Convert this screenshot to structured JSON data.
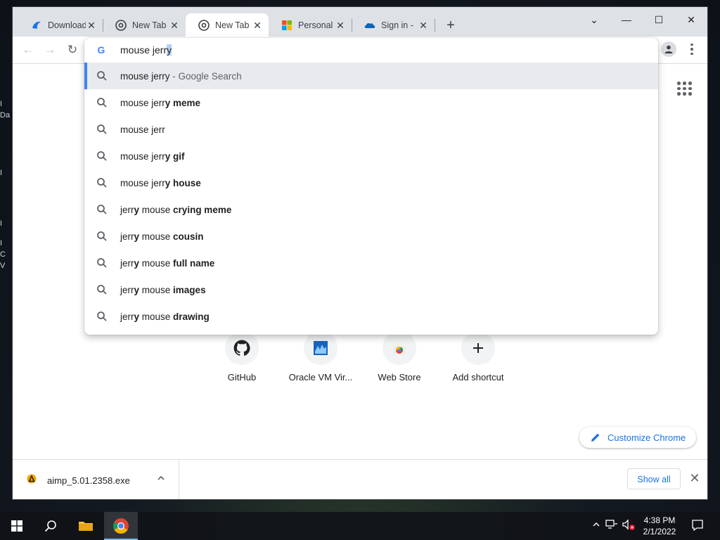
{
  "window": {
    "tabs": [
      {
        "title": "Download",
        "favicon": "download-favicon"
      },
      {
        "title": "New Tab",
        "favicon": "chrome-favicon"
      },
      {
        "title": "New Tab",
        "favicon": "chrome-favicon",
        "active": true
      },
      {
        "title": "Personal",
        "favicon": "microsoft-favicon"
      },
      {
        "title": "Sign in - ",
        "favicon": "onedrive-favicon"
      }
    ],
    "new_tab_label": "+",
    "controls": {
      "tab_search": "⌄",
      "minimize": "—",
      "maximize": "☐",
      "close": "✕"
    }
  },
  "toolbar": {
    "back": "←",
    "forward": "→",
    "reload": "↻"
  },
  "omnibox": {
    "typed_prefix": "mouse jerr",
    "typed_selected": "y",
    "suggestions": [
      {
        "plain": "mouse jerry",
        "bold": "",
        "hint": " - Google Search",
        "selected": true
      },
      {
        "plain": "mouse jerr",
        "bold": "y meme",
        "hint": ""
      },
      {
        "plain": "mouse jerr",
        "bold": "",
        "hint": ""
      },
      {
        "plain": "mouse jerr",
        "bold": "y gif",
        "hint": ""
      },
      {
        "plain": "mouse jerr",
        "bold": "y house",
        "hint": ""
      },
      {
        "plain": "jerr",
        "bold": "y",
        "rest": " mouse ",
        "bold2": "crying meme"
      },
      {
        "plain": "jerr",
        "bold": "y",
        "rest": " mouse ",
        "bold2": "cousin"
      },
      {
        "plain": "jerr",
        "bold": "y",
        "rest": " mouse ",
        "bold2": "full name"
      },
      {
        "plain": "jerr",
        "bold": "y",
        "rest": " mouse ",
        "bold2": "images"
      },
      {
        "plain": "jerr",
        "bold": "y",
        "rest": " mouse ",
        "bold2": "drawing"
      }
    ]
  },
  "ntp": {
    "shortcuts": [
      {
        "label": "GitHub",
        "icon": "github-icon"
      },
      {
        "label": "Oracle VM Vir...",
        "icon": "virtualbox-icon"
      },
      {
        "label": "Web Store",
        "icon": "webstore-icon"
      },
      {
        "label": "Add shortcut",
        "icon": "plus-icon"
      }
    ],
    "customize_label": "Customize Chrome"
  },
  "download_shelf": {
    "file_name": "aimp_5.01.2358.exe",
    "show_all_label": "Show all"
  },
  "taskbar": {
    "time": "4:38 PM",
    "date": "2/1/2022"
  },
  "colors": {
    "accent": "#1a73e8",
    "selection_bar": "#4285f4",
    "titlebar": "#dee1e6"
  }
}
